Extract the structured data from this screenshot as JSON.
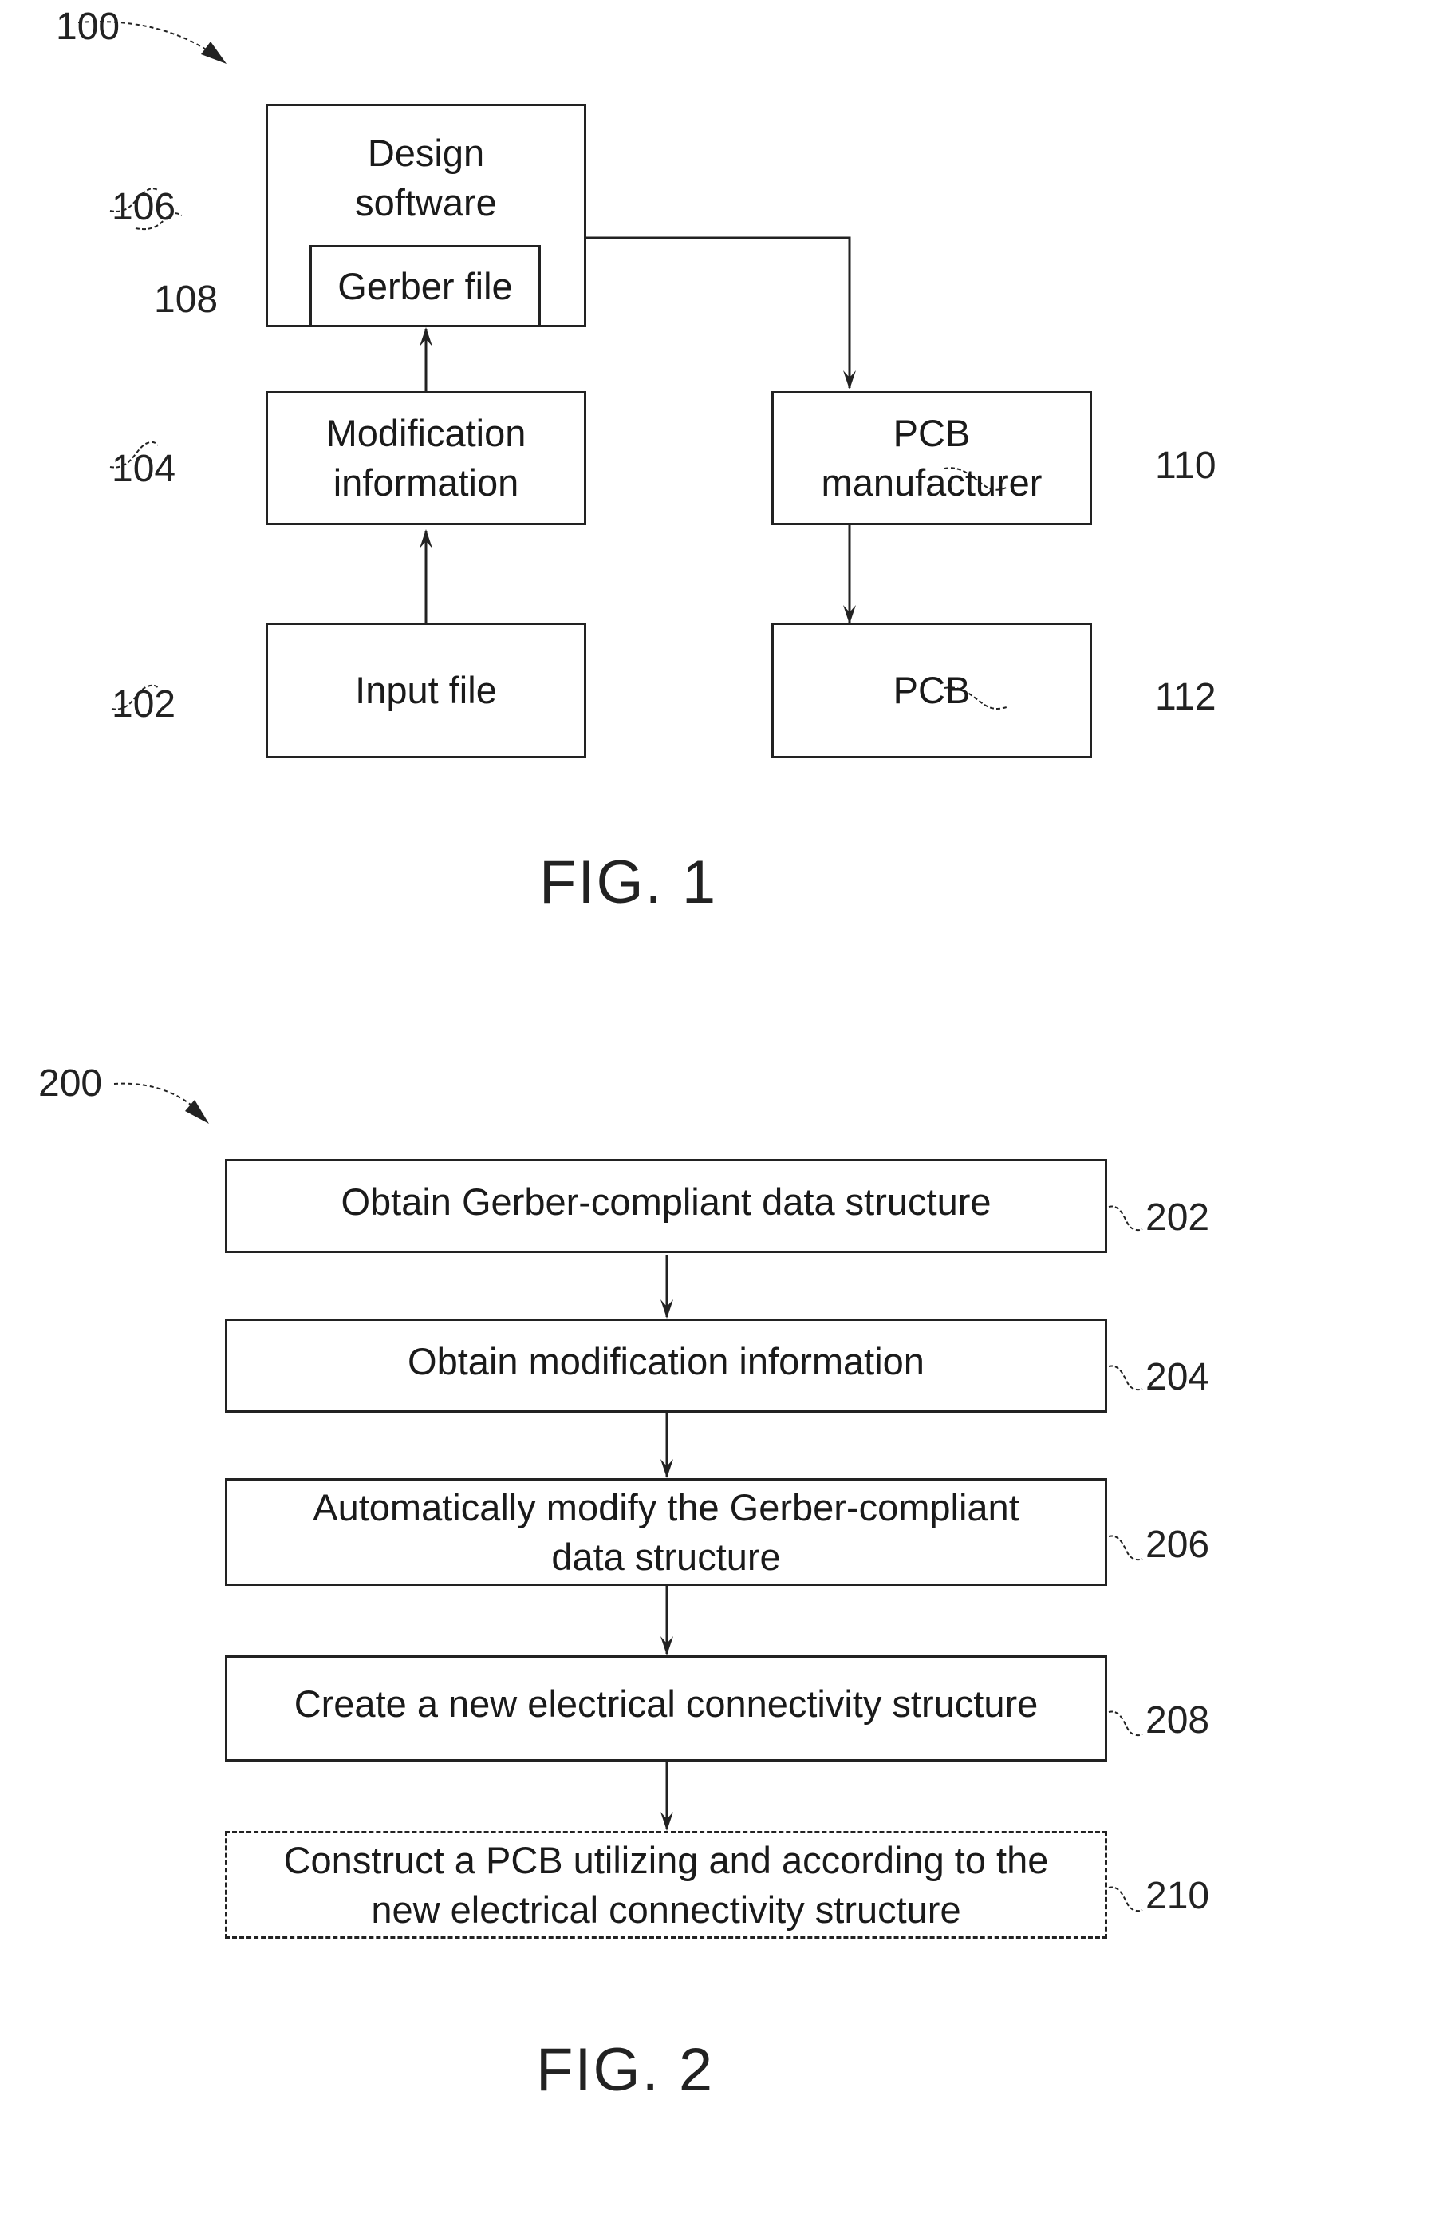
{
  "figure1": {
    "ref": "100",
    "caption": "FIG. 1",
    "nodes": {
      "design_software": {
        "ref": "106",
        "lines": [
          "Design",
          "software"
        ]
      },
      "gerber_file": {
        "ref": "108",
        "lines": [
          "Gerber file"
        ]
      },
      "modification_information": {
        "ref": "104",
        "lines": [
          "Modification",
          "information"
        ]
      },
      "input_file": {
        "ref": "102",
        "lines": [
          "Input file"
        ]
      },
      "pcb_manufacturer": {
        "ref": "110",
        "lines": [
          "PCB",
          "manufacturer"
        ]
      },
      "pcb": {
        "ref": "112",
        "lines": [
          "PCB"
        ]
      }
    },
    "edges": [
      [
        "input_file",
        "modification_information"
      ],
      [
        "modification_information",
        "gerber_file"
      ],
      [
        "design_software",
        "pcb_manufacturer"
      ],
      [
        "pcb_manufacturer",
        "pcb"
      ]
    ]
  },
  "figure2": {
    "ref": "200",
    "caption": "FIG. 2",
    "steps": [
      {
        "ref": "202",
        "lines": [
          "Obtain Gerber-compliant data structure"
        ],
        "optional": false
      },
      {
        "ref": "204",
        "lines": [
          "Obtain modification information"
        ],
        "optional": false
      },
      {
        "ref": "206",
        "lines": [
          "Automatically modify the Gerber-compliant",
          "data structure"
        ],
        "optional": false
      },
      {
        "ref": "208",
        "lines": [
          "Create a new electrical connectivity structure"
        ],
        "optional": false
      },
      {
        "ref": "210",
        "lines": [
          "Construct a PCB utilizing and according to the",
          "new electrical connectivity structure"
        ],
        "optional": true
      }
    ]
  }
}
